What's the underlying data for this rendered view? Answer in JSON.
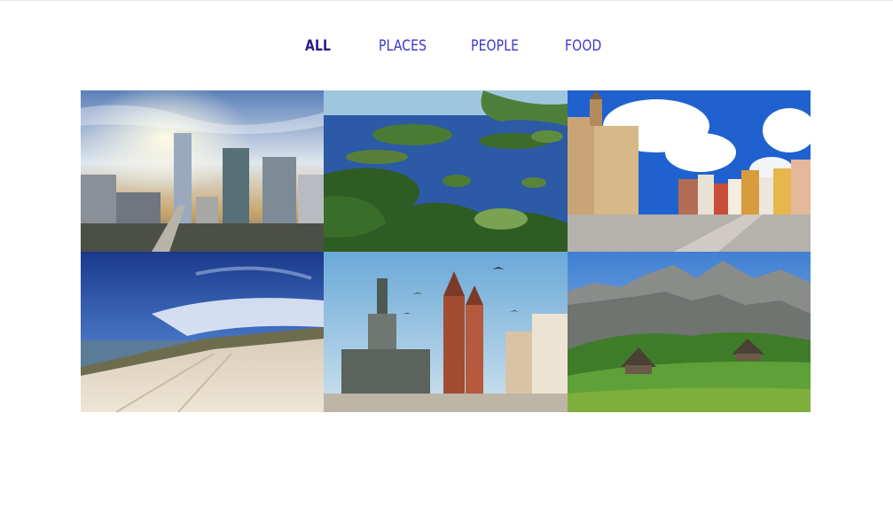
{
  "filters": {
    "all": "ALL",
    "places": "PLACES",
    "people": "PEOPLE",
    "food": "FOOD"
  },
  "colors": {
    "active_filter": "#2c1a86",
    "filter": "#3a35c9"
  },
  "gallery": [
    "warsaw-skyline-photo",
    "masurian-lakes-aerial-photo",
    "wroclaw-market-square-photo",
    "baltic-beach-photo",
    "krakow-main-square-photo",
    "tatra-mountains-huts-photo"
  ]
}
